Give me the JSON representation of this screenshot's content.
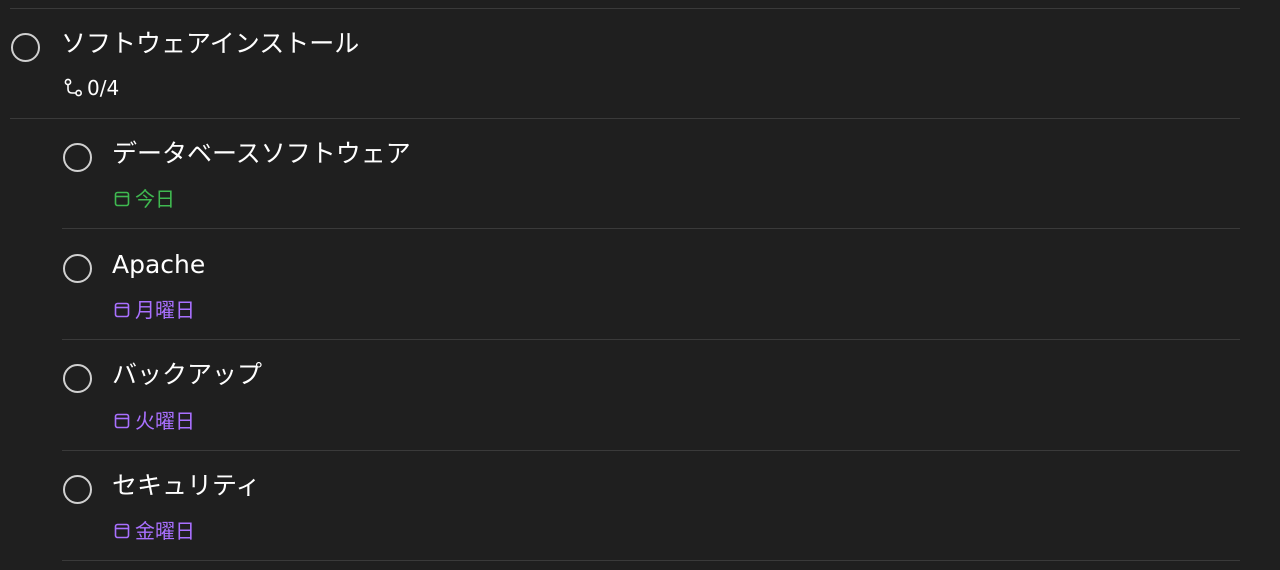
{
  "colors": {
    "background": "#1f1f1f",
    "divider": "#3a3a3a",
    "text": "#ffffff",
    "today": "#3fb950",
    "weekday": "#a970ff",
    "circle": "#d0d0d0"
  },
  "parent_task": {
    "title": "ソフトウェアインストール",
    "subtask_progress": "0/4",
    "icon": "subtask-icon"
  },
  "subtasks": [
    {
      "title": "データベースソフトウェア",
      "due": "今日",
      "due_color": "#3fb950",
      "icon": "calendar-icon"
    },
    {
      "title": "Apache",
      "due": "月曜日",
      "due_color": "#a970ff",
      "icon": "calendar-icon"
    },
    {
      "title": "バックアップ",
      "due": "火曜日",
      "due_color": "#a970ff",
      "icon": "calendar-icon"
    },
    {
      "title": "セキュリティ",
      "due": "金曜日",
      "due_color": "#a970ff",
      "icon": "calendar-icon"
    }
  ]
}
